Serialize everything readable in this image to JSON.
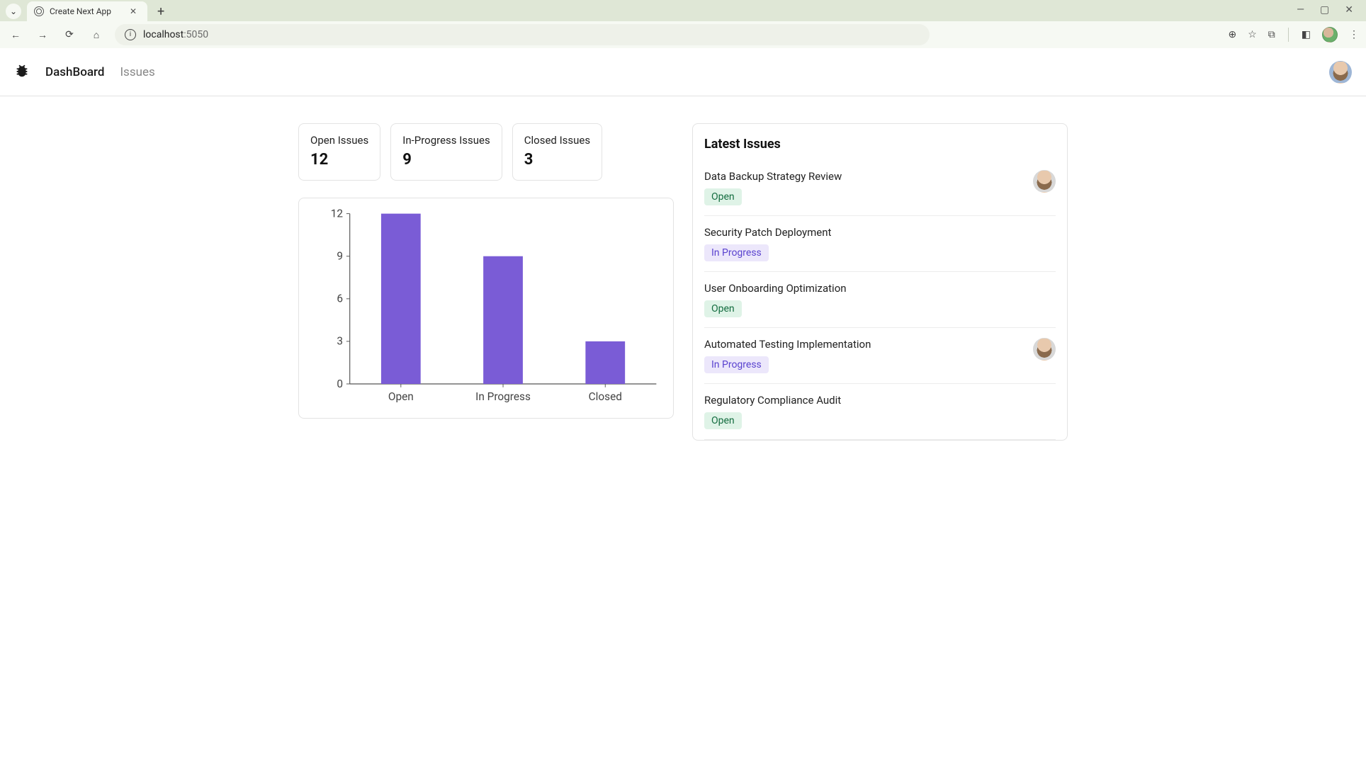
{
  "browser": {
    "tab_title": "Create Next App",
    "url_display": "localhost",
    "url_port": ":5050"
  },
  "nav": {
    "dashboard": "DashBoard",
    "issues": "Issues"
  },
  "stats": [
    {
      "label": "Open Issues",
      "value": "12"
    },
    {
      "label": "In-Progress Issues",
      "value": "9"
    },
    {
      "label": "Closed Issues",
      "value": "3"
    }
  ],
  "chart_data": {
    "type": "bar",
    "categories": [
      "Open",
      "In Progress",
      "Closed"
    ],
    "values": [
      12,
      9,
      3
    ],
    "ylim": [
      0,
      12
    ],
    "yticks": [
      0,
      3,
      6,
      9,
      12
    ],
    "title": "",
    "xlabel": "",
    "ylabel": ""
  },
  "latest": {
    "heading": "Latest Issues",
    "badge_labels": {
      "open": "Open",
      "progress": "In Progress"
    },
    "items": [
      {
        "title": "Data Backup Strategy Review",
        "status": "open",
        "has_avatar": true
      },
      {
        "title": "Security Patch Deployment",
        "status": "progress",
        "has_avatar": false
      },
      {
        "title": "User Onboarding Optimization",
        "status": "open",
        "has_avatar": false
      },
      {
        "title": "Automated Testing Implementation",
        "status": "progress",
        "has_avatar": true
      },
      {
        "title": "Regulatory Compliance Audit",
        "status": "open",
        "has_avatar": false
      }
    ]
  }
}
